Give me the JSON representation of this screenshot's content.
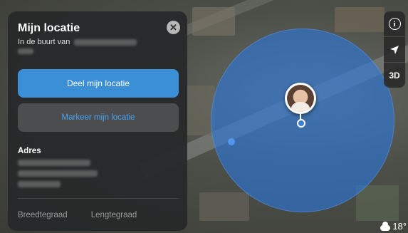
{
  "panel": {
    "title": "Mijn locatie",
    "subtitle_prefix": "In de buurt van",
    "primary_button": "Deel mijn locatie",
    "secondary_button": "Markeer mijn locatie",
    "address_heading": "Adres",
    "latitude_label": "Breedtegraad",
    "longitude_label": "Lengtegraad"
  },
  "controls": {
    "info_icon": "info-icon",
    "location_icon": "location-arrow-icon",
    "mode_3d": "3D"
  },
  "weather": {
    "icon": "cloud-icon",
    "temperature": "18°"
  },
  "colors": {
    "accent": "#3b8fd6",
    "accuracy_circle": "#2c78dc"
  }
}
